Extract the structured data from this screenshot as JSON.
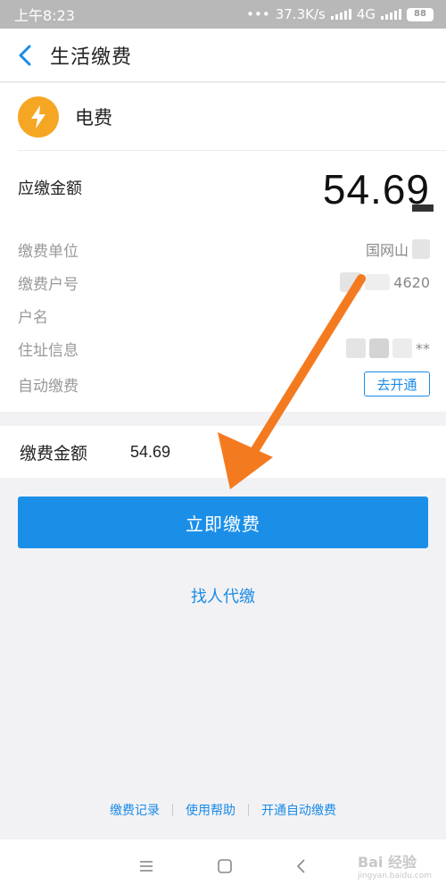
{
  "status_bar": {
    "time": "上午8:23",
    "network_speed": "37.3K/s",
    "network_type": "4G",
    "battery": "88"
  },
  "nav": {
    "title": "生活缴费"
  },
  "service": {
    "name": "电费",
    "icon": "lightning-icon",
    "icon_color": "#f5a623"
  },
  "bill": {
    "due_label": "应缴金额",
    "due_amount": "54.69",
    "details": [
      {
        "label": "缴费单位",
        "value": "国网山"
      },
      {
        "label": "缴费户号",
        "value": "4620"
      },
      {
        "label": "户名",
        "value": ""
      },
      {
        "label": "住址信息",
        "value": "**"
      },
      {
        "label": "自动缴费",
        "button": "去开通"
      }
    ]
  },
  "payment": {
    "label": "缴费金额",
    "value": "54.69",
    "pay_button": "立即缴费",
    "proxy_link": "找人代缴"
  },
  "footer": {
    "links": [
      "缴费记录",
      "使用帮助",
      "开通自动缴费"
    ]
  },
  "watermark": {
    "text": "Bai 经验",
    "sub": "jingyan.baidu.com"
  },
  "colors": {
    "accent": "#1b8fe8",
    "annotation_arrow": "#f47a20"
  }
}
